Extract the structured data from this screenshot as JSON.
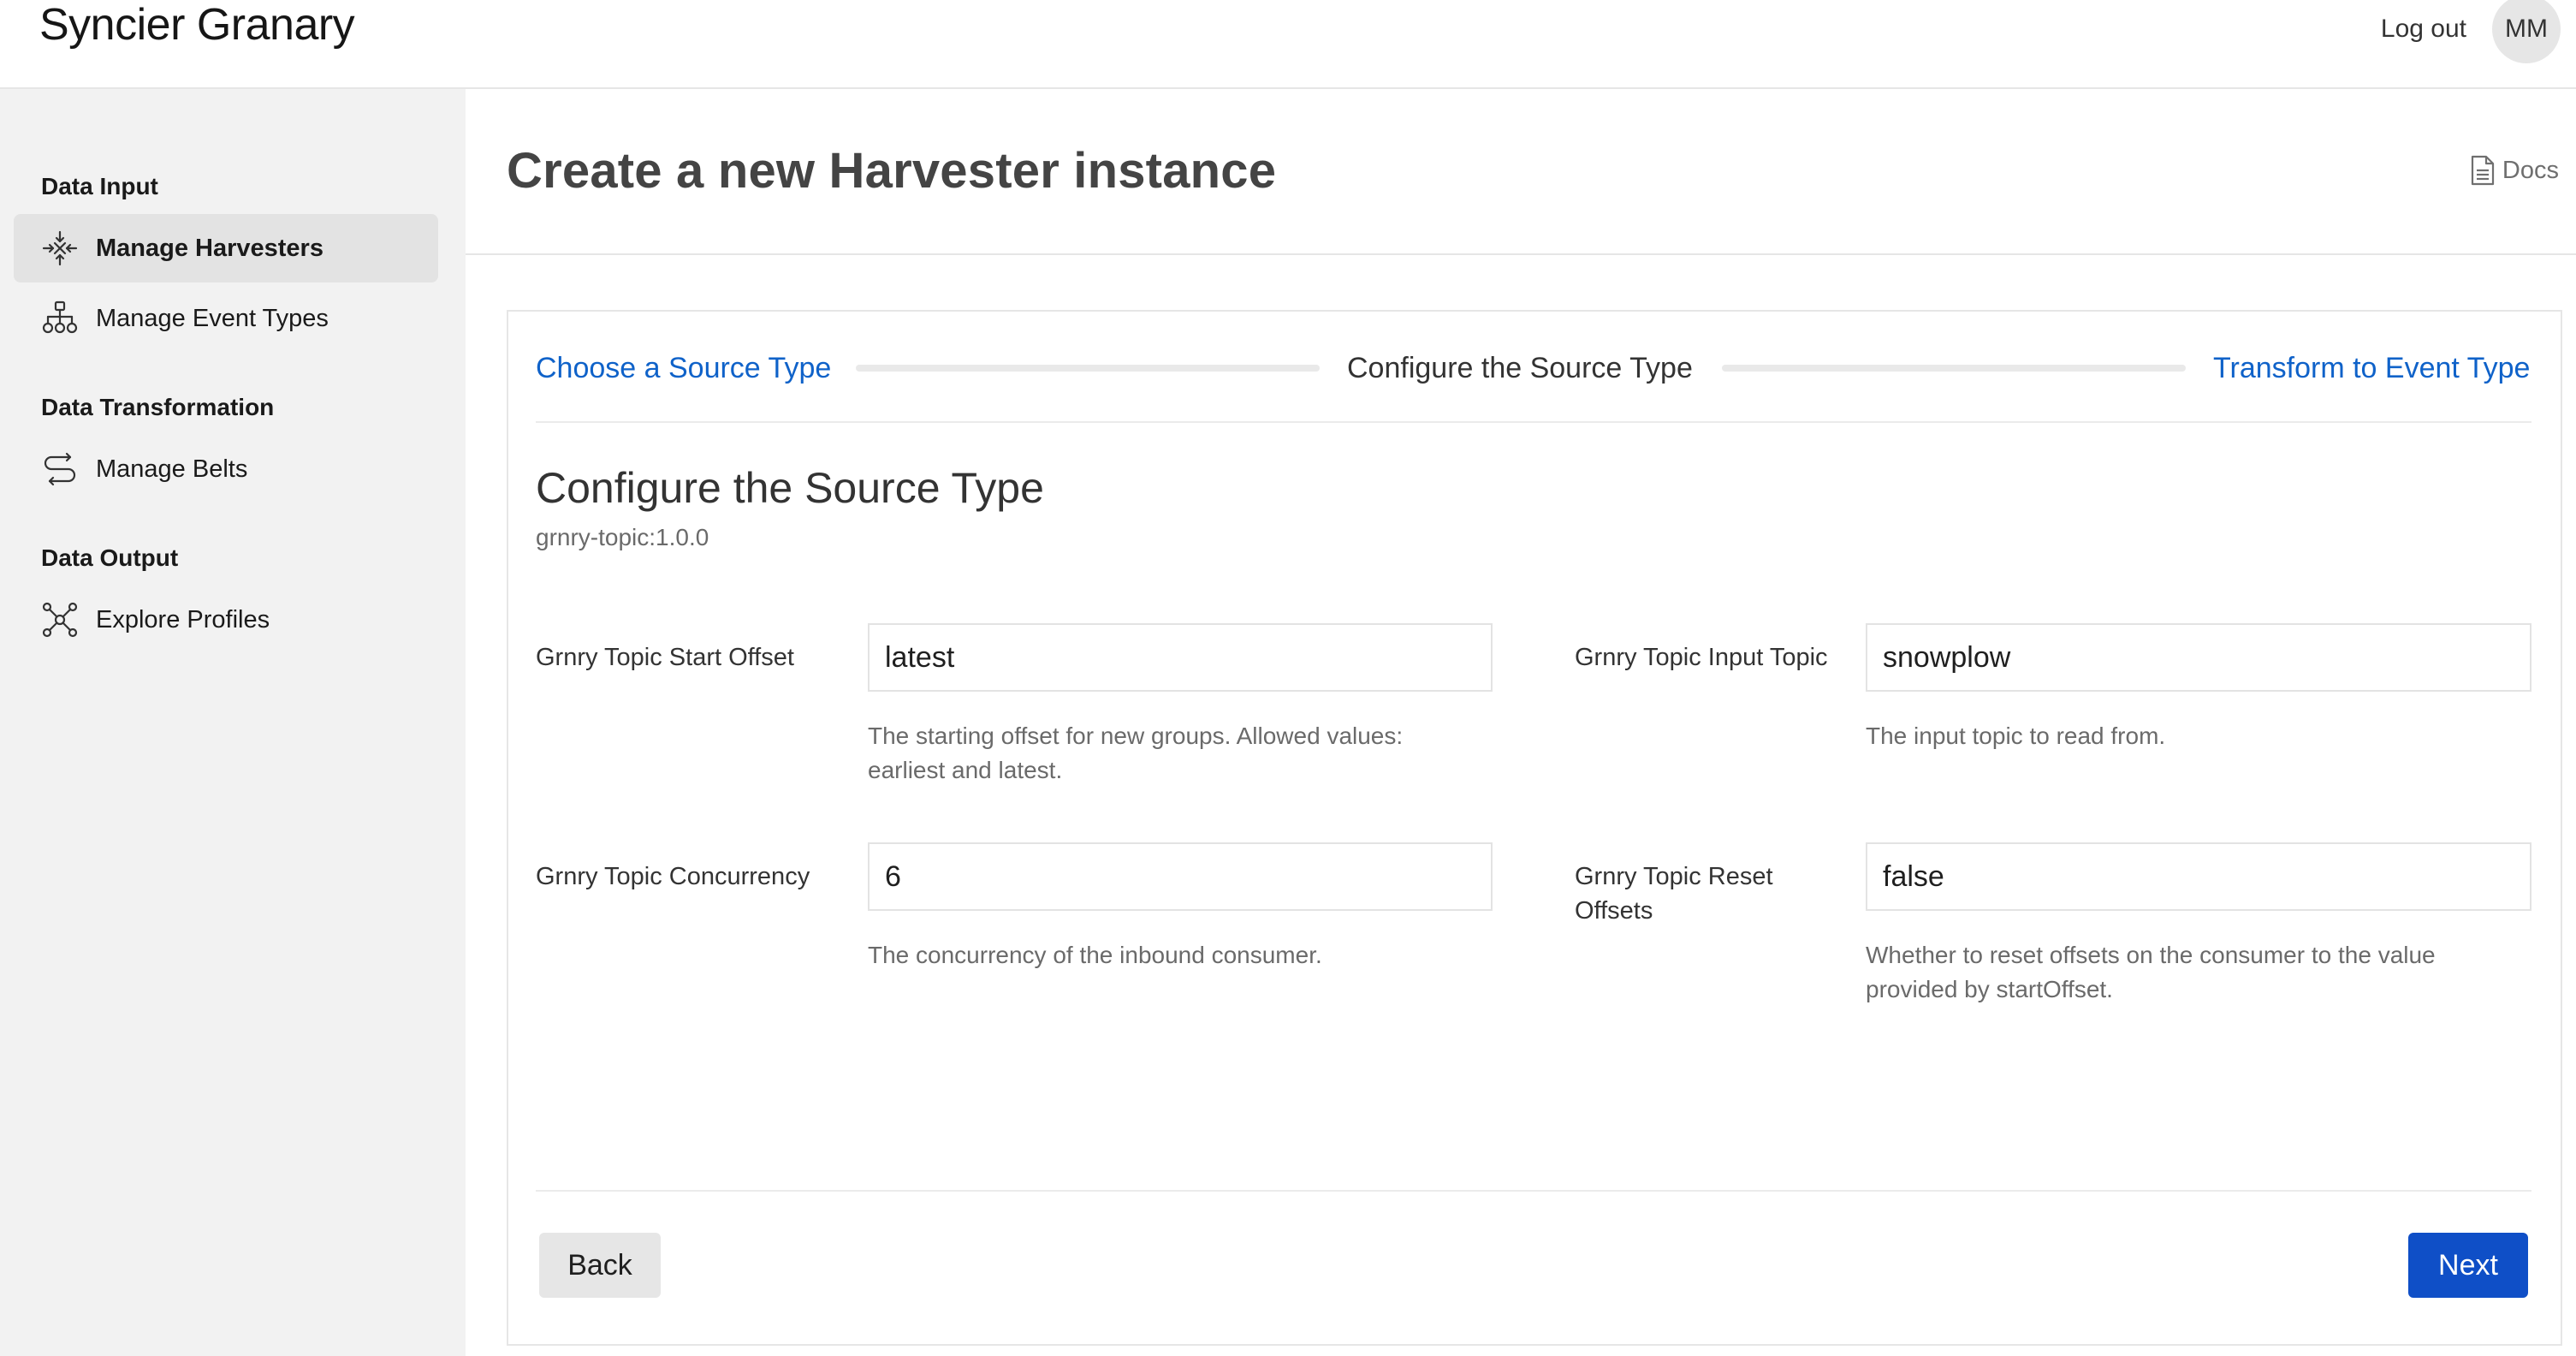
{
  "header": {
    "app_title": "Syncier Granary",
    "logout_label": "Log out",
    "avatar_initials": "MM"
  },
  "sidebar": {
    "sections": [
      {
        "title": "Data Input",
        "items": [
          {
            "label": "Manage Harvesters",
            "icon": "harvester-icon",
            "active": true
          },
          {
            "label": "Manage Event Types",
            "icon": "hierarchy-icon",
            "active": false
          }
        ]
      },
      {
        "title": "Data Transformation",
        "items": [
          {
            "label": "Manage Belts",
            "icon": "belt-icon",
            "active": false
          }
        ]
      },
      {
        "title": "Data Output",
        "items": [
          {
            "label": "Explore Profiles",
            "icon": "network-icon",
            "active": false
          }
        ]
      }
    ]
  },
  "main": {
    "page_title": "Create a new Harvester instance",
    "docs_label": "Docs",
    "stepper": {
      "steps": [
        {
          "label": "Choose a Source Type",
          "state": "link"
        },
        {
          "label": "Configure the Source Type",
          "state": "current"
        },
        {
          "label": "Transform to Event Type",
          "state": "link"
        }
      ]
    },
    "section_title": "Configure the Source Type",
    "section_subtitle": "grnry-topic:1.0.0",
    "fields": [
      {
        "label": "Grnry Topic Start Offset",
        "value": "latest",
        "help": "The starting offset for new groups. Allowed values: earliest and latest."
      },
      {
        "label": "Grnry Topic Input Topic",
        "value": "snowplow",
        "help": "The input topic to read from."
      },
      {
        "label": "Grnry Topic Concurrency",
        "value": "6",
        "help": "The concurrency of the inbound consumer."
      },
      {
        "label": "Grnry Topic Reset Offsets",
        "value": "false",
        "help": "Whether to reset offsets on the consumer to the value provided by startOffset."
      }
    ],
    "back_label": "Back",
    "next_label": "Next"
  },
  "colors": {
    "link": "#0f62c9",
    "primary_button": "#0f4fc7",
    "sidebar_bg": "#f2f2f2",
    "active_item_bg": "#e3e3e3"
  }
}
